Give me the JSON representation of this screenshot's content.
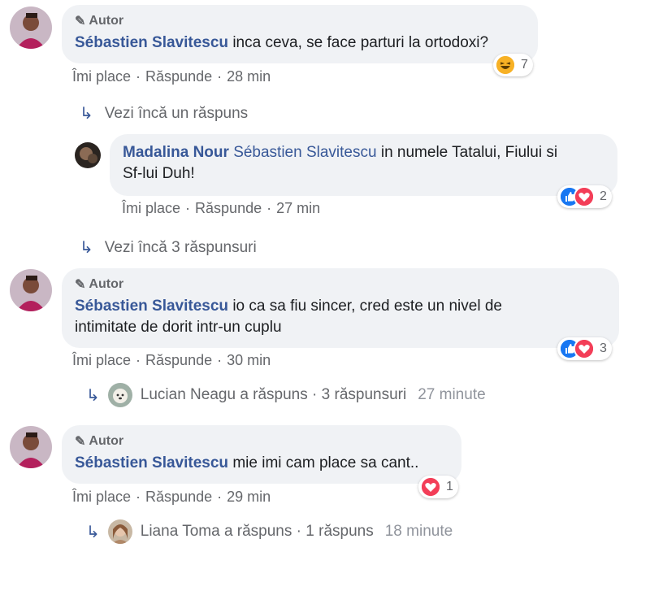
{
  "comments": [
    {
      "author_tag": "Autor",
      "name": "Sébastien Slavitescu",
      "text": "inca ceva, se face parturi la ortodoxi?",
      "like": "Îmi place",
      "reply": "Răspunde",
      "time": "28 min",
      "reaction_count": "7",
      "more_replies": "Vezi încă un răspuns"
    },
    {
      "name": "Madalina Nour",
      "mention": "Sébastien Slavitescu",
      "text_line1": "in numele Tatalui, Fiului si",
      "text_line2": "Sf-lui Duh!",
      "like": "Îmi place",
      "reply": "Răspunde",
      "time": "27 min",
      "reaction_count": "2",
      "more_replies": "Vezi încă 3 răspunsuri"
    },
    {
      "author_tag": "Autor",
      "name": "Sébastien Slavitescu",
      "text_line1": "io ca sa fiu sincer, cred este un nivel de",
      "text_line2": "intimitate de dorit intr-un cuplu",
      "like": "Îmi place",
      "reply": "Răspunde",
      "time": "30 min",
      "reaction_count": "3",
      "reply_summary": {
        "name": "Lucian Neagu",
        "verb": "a răspuns",
        "count": "3 răspunsuri",
        "time": "27 minute"
      }
    },
    {
      "author_tag": "Autor",
      "name": "Sébastien Slavitescu",
      "text": "mie imi cam place sa cant..",
      "like": "Îmi place",
      "reply": "Răspunde",
      "time": "29 min",
      "reaction_count": "1",
      "reply_summary": {
        "name": "Liana Toma",
        "verb": "a răspuns",
        "count": "1 răspuns",
        "time": "18 minute"
      }
    }
  ],
  "separator": "·",
  "colors": {
    "name": "#385898",
    "bubble": "#f0f2f5",
    "meta": "#65676b",
    "like_blue": "#1877f2",
    "love_red": "#f33e58",
    "haha_yellow": "#f7b125"
  }
}
